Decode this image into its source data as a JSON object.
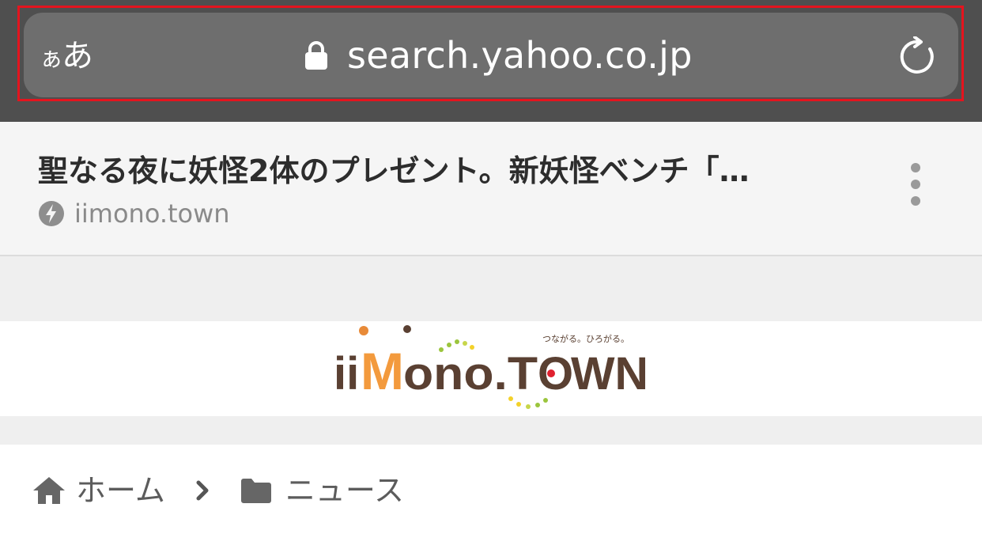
{
  "browser": {
    "text_size_button": {
      "small": "ぁ",
      "large": "あ"
    },
    "url": "search.yahoo.co.jp",
    "icons": {
      "lock": "lock-icon",
      "reload": "reload-icon"
    }
  },
  "amp_header": {
    "title": "聖なる夜に妖怪2体のプレゼント。新妖怪ベンチ「…",
    "domain": "iimono.town",
    "icons": {
      "source": "lightning-icon",
      "menu": "more-vertical-icon"
    }
  },
  "logo": {
    "brand_parts": [
      "ii",
      "M",
      "ono.T",
      "O",
      "WN"
    ],
    "tagline": "つながる。ひろがる。"
  },
  "breadcrumb": {
    "home_label": "ホーム",
    "current_label": "ニュース",
    "icons": {
      "home": "home-icon",
      "separator": "chevron-right-icon",
      "folder": "folder-icon"
    }
  },
  "colors": {
    "highlight": "#e4141e",
    "brand_orange": "#f39a3d",
    "brand_brown": "#5a4032",
    "brand_red_dot": "#e0212f",
    "brand_green": "#9bc53d",
    "brand_yellow": "#f3d12a"
  }
}
